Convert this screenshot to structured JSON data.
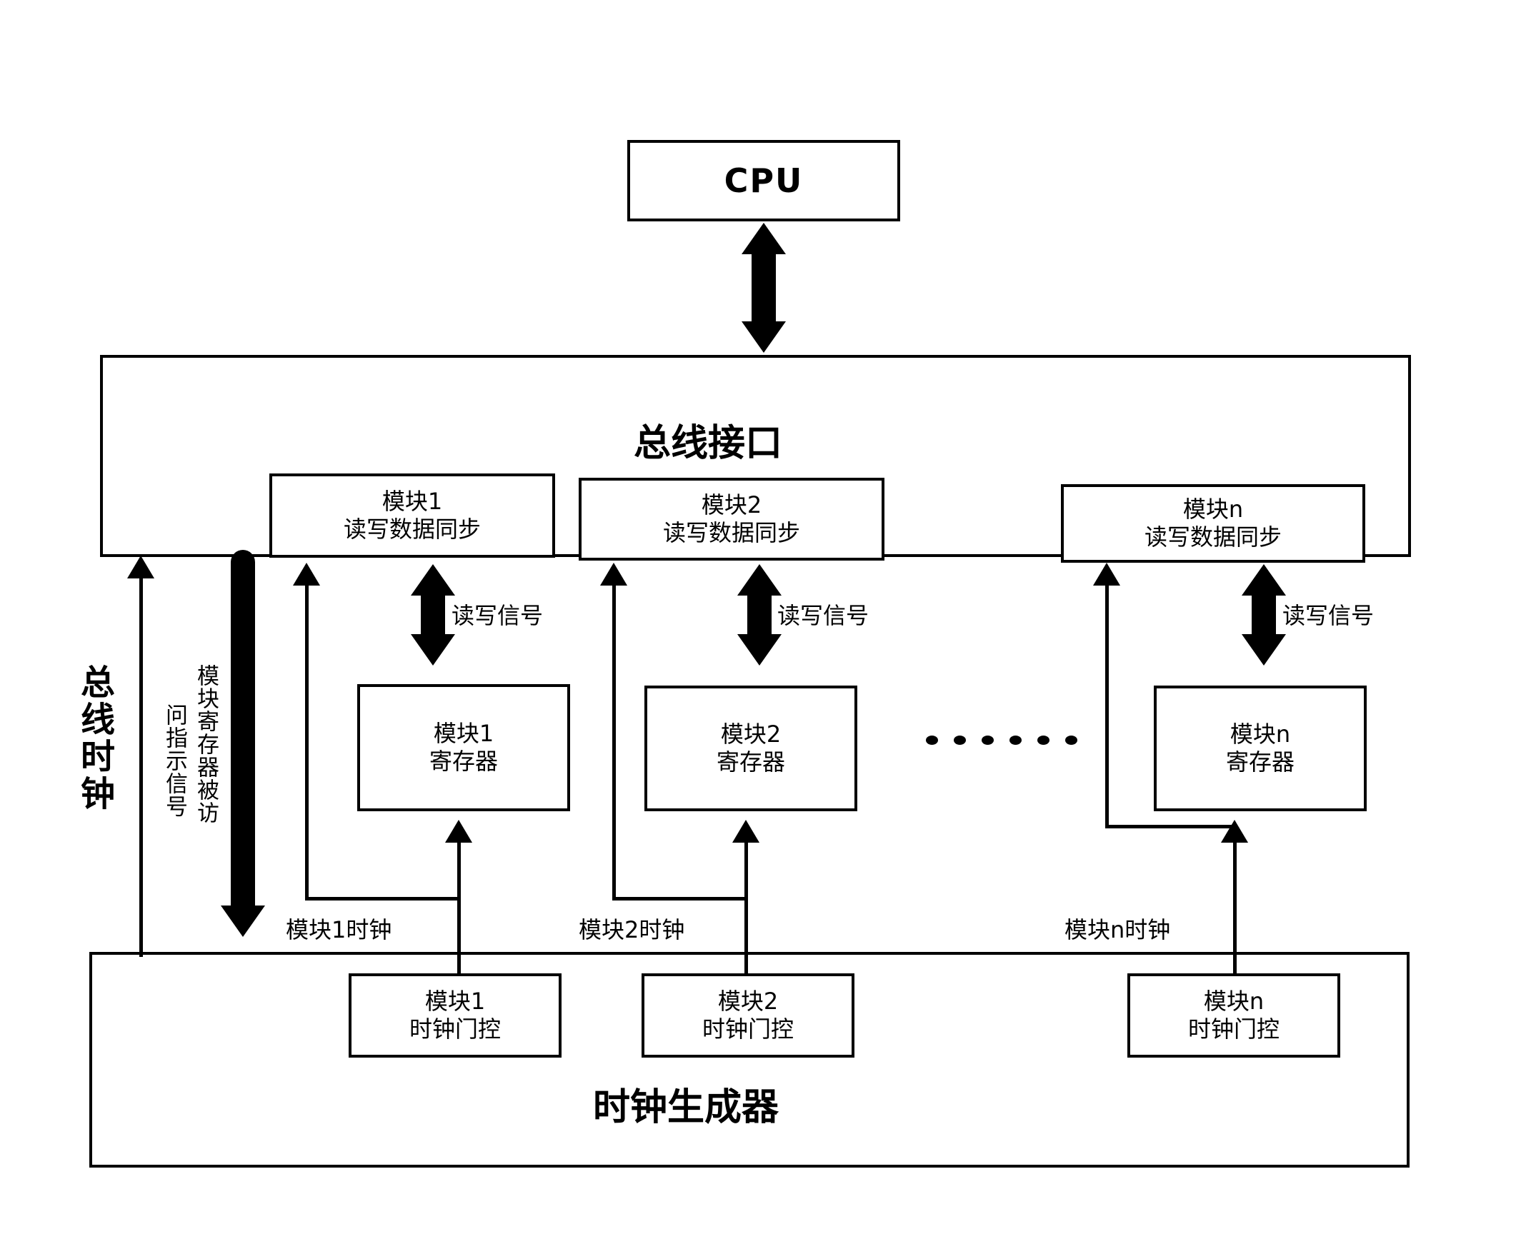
{
  "diagram": {
    "title_cpu": "CPU",
    "bus_interface_title": "总线接口",
    "clock_generator_title": "时钟生成器",
    "vertical_labels": {
      "bus_clock": "总线时钟",
      "reg_access_col_right": "模块寄存器被访",
      "reg_access_col_left": "问指示信号"
    },
    "modules": [
      {
        "sync_line1": "模块1",
        "sync_line2": "读写数据同步",
        "rw_signal": "读写信号",
        "register_line1": "模块1",
        "register_line2": "寄存器",
        "clock_label": "模块1时钟",
        "gate_line1": "模块1",
        "gate_line2": "时钟门控"
      },
      {
        "sync_line1": "模块2",
        "sync_line2": "读写数据同步",
        "rw_signal": "读写信号",
        "register_line1": "模块2",
        "register_line2": "寄存器",
        "clock_label": "模块2时钟",
        "gate_line1": "模块2",
        "gate_line2": "时钟门控"
      },
      {
        "sync_line1": "模块n",
        "sync_line2": "读写数据同步",
        "rw_signal": "读写信号",
        "register_line1": "模块n",
        "register_line2": "寄存器",
        "clock_label": "模块n时钟",
        "gate_line1": "模块n",
        "gate_line2": "时钟门控"
      }
    ],
    "ellipsis_dot_count": 6,
    "colors": {
      "stroke": "#000000",
      "background": "#ffffff"
    }
  }
}
